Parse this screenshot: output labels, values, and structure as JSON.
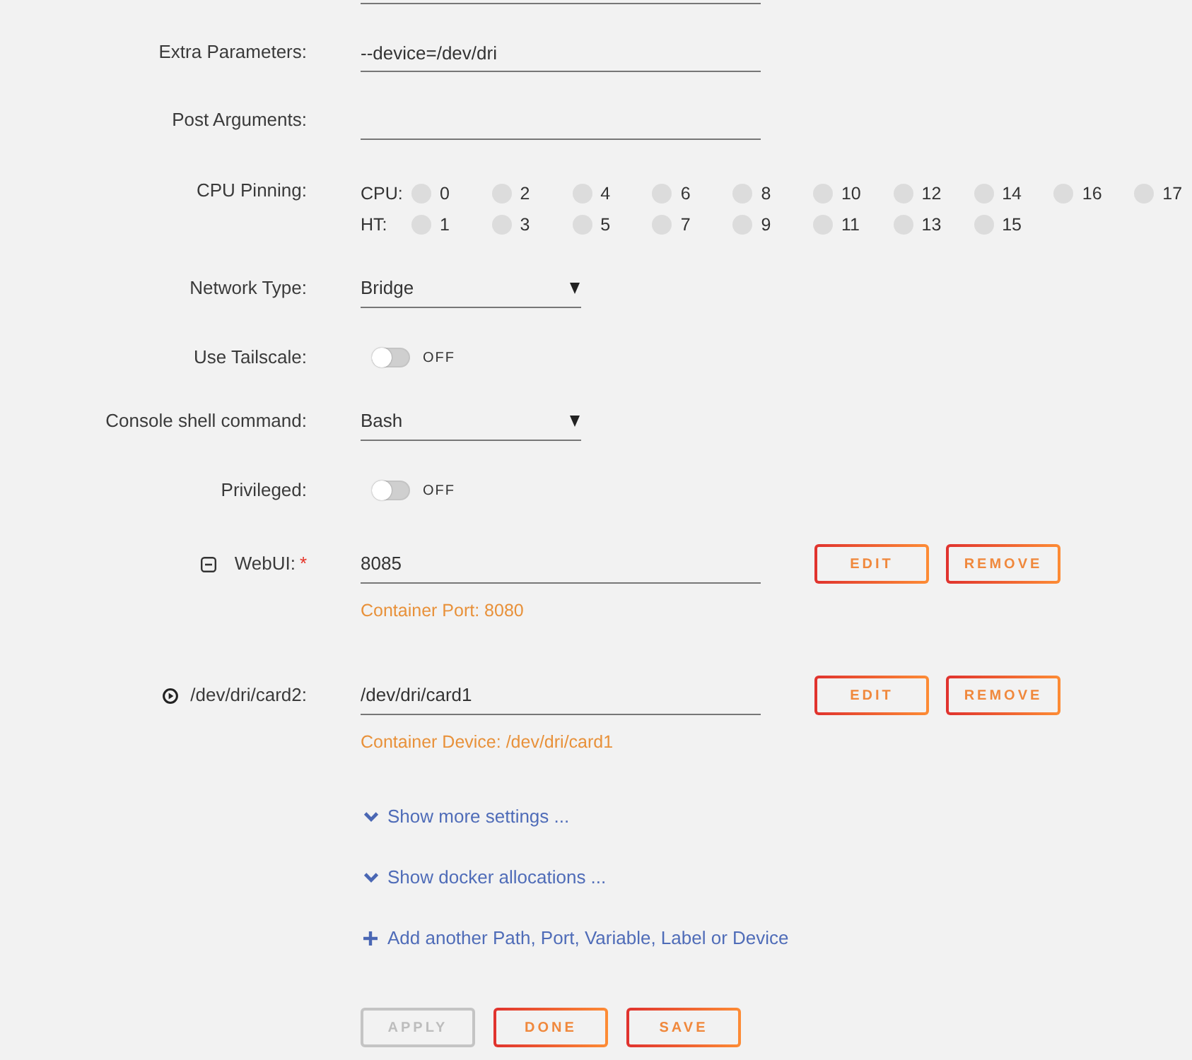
{
  "form": {
    "rows": [
      {
        "kind": "edge"
      },
      {
        "kind": "text",
        "label": "Extra Parameters:",
        "value": "--device=/dev/dri"
      },
      {
        "kind": "text",
        "label": "Post Arguments:"
      },
      {
        "kind": "cpu",
        "label": "CPU Pinning:",
        "cpu_label": "CPU:",
        "ht_label": "HT:",
        "cpu": [
          {
            "label": "0",
            "checked": false
          },
          {
            "label": "2",
            "checked": false
          },
          {
            "label": "4",
            "checked": false
          },
          {
            "label": "6",
            "checked": false
          },
          {
            "label": "8",
            "checked": false
          },
          {
            "label": "10",
            "checked": false
          },
          {
            "label": "12",
            "checked": false
          },
          {
            "label": "14",
            "checked": false
          },
          {
            "label": "16",
            "checked": false
          },
          {
            "label": "17",
            "checked": false
          }
        ],
        "ht": [
          {
            "label": "1",
            "checked": false
          },
          {
            "label": "3",
            "checked": false
          },
          {
            "label": "5",
            "checked": false
          },
          {
            "label": "7",
            "checked": false
          },
          {
            "label": "9",
            "checked": false
          },
          {
            "label": "11",
            "checked": false
          },
          {
            "label": "13",
            "checked": false
          },
          {
            "label": "15",
            "checked": false
          }
        ]
      },
      {
        "kind": "select",
        "label": "Network Type:",
        "value": "Bridge"
      },
      {
        "kind": "toggle",
        "label": "Use Tailscale:",
        "on": false,
        "state_text": "OFF"
      },
      {
        "kind": "select",
        "label": "Console shell command:",
        "value": "Bash"
      },
      {
        "kind": "toggle",
        "label": "Privileged:",
        "on": false,
        "state_text": "OFF"
      },
      {
        "kind": "port",
        "label": "WebUI:",
        "required_mark": "*",
        "value": "8085",
        "note": "Container Port: 8080",
        "buttons": [
          "EDIT",
          "REMOVE"
        ]
      },
      {
        "kind": "device",
        "label": "/dev/dri/card2:",
        "value": "/dev/dri/card1",
        "note": "Container Device: /dev/dri/card1",
        "buttons": [
          "EDIT",
          "REMOVE"
        ]
      }
    ],
    "links": [
      {
        "kind": "expand",
        "label": "Show more settings ..."
      },
      {
        "kind": "expand",
        "label": "Show docker allocations ..."
      },
      {
        "kind": "add",
        "label": "Add another Path, Port, Variable, Label or Device"
      }
    ],
    "actions": [
      {
        "label": "APPLY",
        "disabled": true
      },
      {
        "label": "DONE",
        "disabled": false
      },
      {
        "label": "SAVE",
        "disabled": false
      }
    ]
  }
}
